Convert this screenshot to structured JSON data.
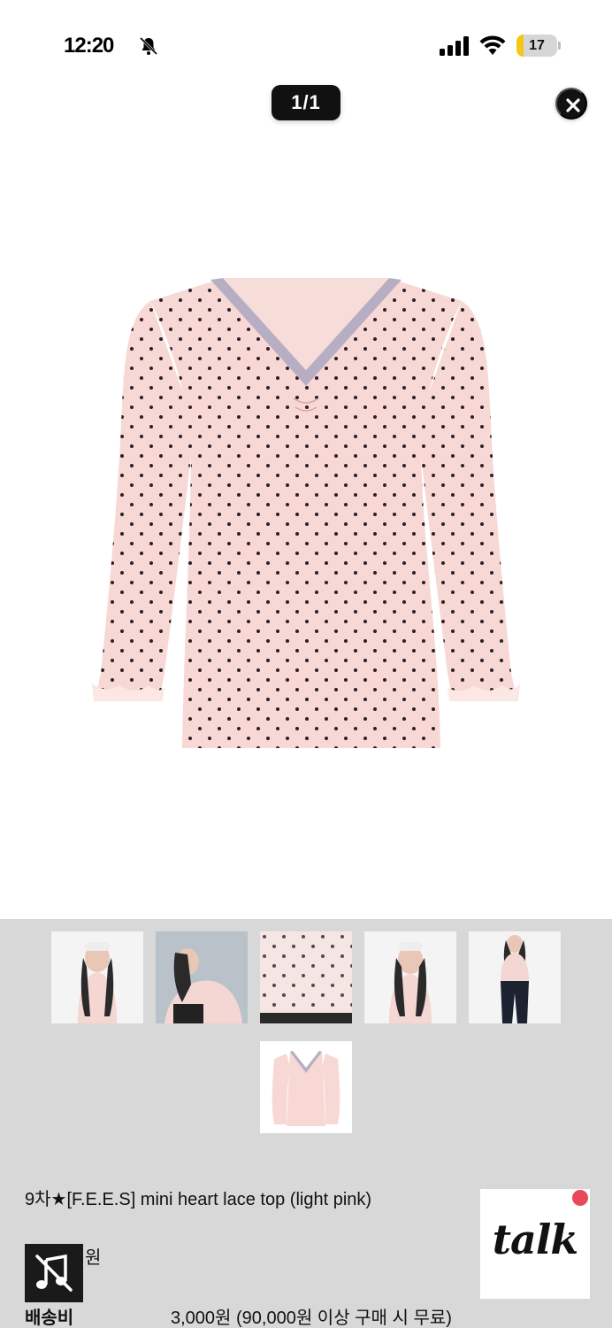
{
  "status_bar": {
    "time": "12:20",
    "battery_level": "17",
    "battery_fraction": 0.17,
    "icons": [
      "bell-off-icon",
      "signal-icon",
      "wifi-icon",
      "battery-icon"
    ]
  },
  "viewer": {
    "page_counter": "1/1",
    "close_icon": "close-icon"
  },
  "colors": {
    "accent_dot": "#e9485a",
    "panel_bg": "#d8d8d8",
    "battery_fill": "#f5c518",
    "shirt_pink": "#f7d8d4",
    "lace_lavender": "#b8aec4"
  },
  "product": {
    "title": "9차★[F.E.E.S] mini heart lace top (light pink)",
    "price": "원",
    "shipping_label": "배송비",
    "shipping_value": "3,000원 (90,000원 이상 구매 시 무료)"
  },
  "thumbnails": {
    "count": 6,
    "selected_index": 5
  },
  "floating": {
    "talk_label": "talk",
    "music_icon": "music-off-icon"
  }
}
